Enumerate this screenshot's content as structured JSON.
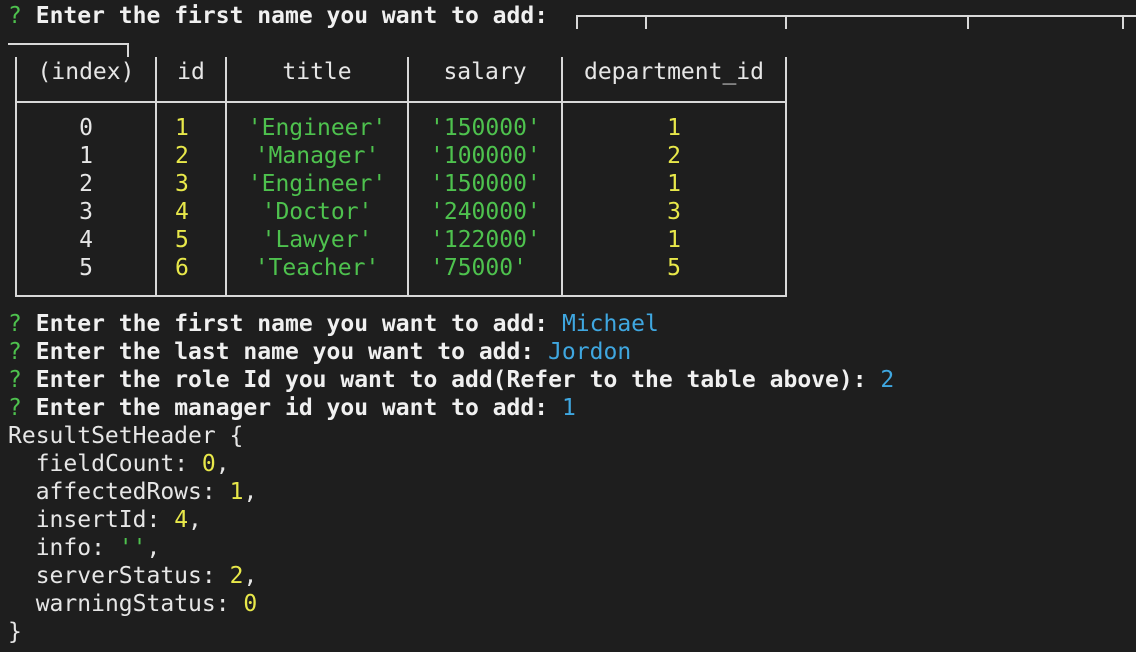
{
  "prompt_top": {
    "mark": "?",
    "text": "Enter the first name you want to add:"
  },
  "table": {
    "headers": [
      "(index)",
      "id",
      "title",
      "salary",
      "department_id"
    ],
    "rows": [
      {
        "index": "0",
        "id": "1",
        "title": "'Engineer'",
        "salary": "'150000'",
        "department_id": "1"
      },
      {
        "index": "1",
        "id": "2",
        "title": "'Manager'",
        "salary": "'100000'",
        "department_id": "2"
      },
      {
        "index": "2",
        "id": "3",
        "title": "'Engineer'",
        "salary": "'150000'",
        "department_id": "1"
      },
      {
        "index": "3",
        "id": "4",
        "title": "'Doctor'",
        "salary": "'240000'",
        "department_id": "3"
      },
      {
        "index": "4",
        "id": "5",
        "title": "'Lawyer'",
        "salary": "'122000'",
        "department_id": "1"
      },
      {
        "index": "5",
        "id": "6",
        "title": "'Teacher'",
        "salary": "'75000'",
        "department_id": "5"
      }
    ]
  },
  "prompts": [
    {
      "mark": "?",
      "text": "Enter the first name you want to add:",
      "answer": "Michael"
    },
    {
      "mark": "?",
      "text": "Enter the last name you want to add:",
      "answer": "Jordon"
    },
    {
      "mark": "?",
      "text": "Enter the role Id you want to add(Refer to the table above):",
      "answer": "2"
    },
    {
      "mark": "?",
      "text": "Enter the manager id you want to add:",
      "answer": "1"
    }
  ],
  "result": {
    "header": "ResultSetHeader {",
    "fields": [
      {
        "key": "fieldCount",
        "value": "0",
        "sep": ","
      },
      {
        "key": "affectedRows",
        "value": "1",
        "sep": ","
      },
      {
        "key": "insertId",
        "value": "4",
        "sep": ","
      },
      {
        "key": "info",
        "value": "''",
        "sep": ","
      },
      {
        "key": "serverStatus",
        "value": "2",
        "sep": ","
      },
      {
        "key": "warningStatus",
        "value": "0",
        "sep": ""
      }
    ],
    "footer": "}"
  }
}
